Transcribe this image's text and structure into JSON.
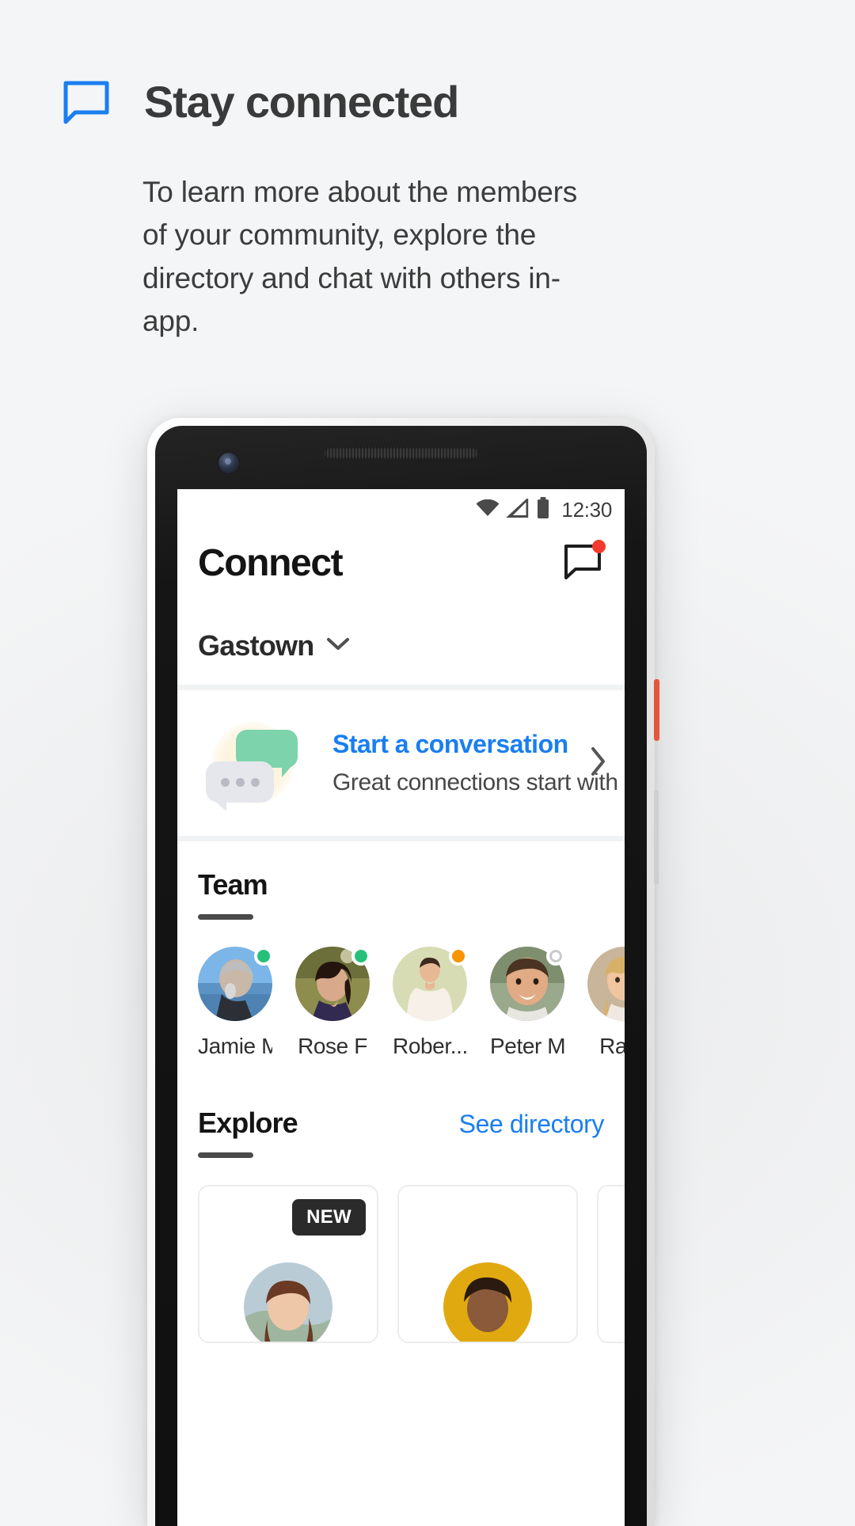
{
  "promo": {
    "icon": "chat-bubble-icon",
    "title": "Stay connected",
    "body": "To learn more about the members of your community, explore the directory and chat with others in-app.",
    "accent_color": "#1a7ef0"
  },
  "phone": {
    "status_bar": {
      "wifi_icon": "wifi-icon",
      "signal_icon": "cellular-signal-icon",
      "battery_icon": "battery-icon",
      "time": "12:30"
    },
    "app_bar": {
      "title": "Connect",
      "chat_icon": "chat-bubble-icon",
      "badge_color": "#f23a2e"
    },
    "community": {
      "name": "Gastown",
      "chevron_icon": "chevron-down-icon"
    },
    "conversation_card": {
      "illustration": "chat-bubbles-illustration",
      "title": "Start a conversation",
      "subtitle": "Great connections start with 👋",
      "chevron_icon": "chevron-right-icon",
      "title_color": "#1a7ef0"
    },
    "team_section": {
      "title": "Team",
      "members": [
        {
          "name": "Jamie M",
          "status": "online",
          "status_color": "#27c07a"
        },
        {
          "name": "Rose F",
          "status": "online",
          "status_color": "#27c07a"
        },
        {
          "name": "Rober...",
          "status": "away",
          "status_color": "#f89406"
        },
        {
          "name": "Peter M",
          "status": "offline",
          "status_color": "#ffffff"
        },
        {
          "name": "Rach",
          "status": "none",
          "status_color": "#ffffff"
        }
      ]
    },
    "explore_section": {
      "title": "Explore",
      "link": "See directory",
      "link_color": "#1a7ef0",
      "cards": [
        {
          "badge": "NEW"
        },
        {
          "badge": ""
        },
        {
          "badge": ""
        }
      ]
    }
  }
}
